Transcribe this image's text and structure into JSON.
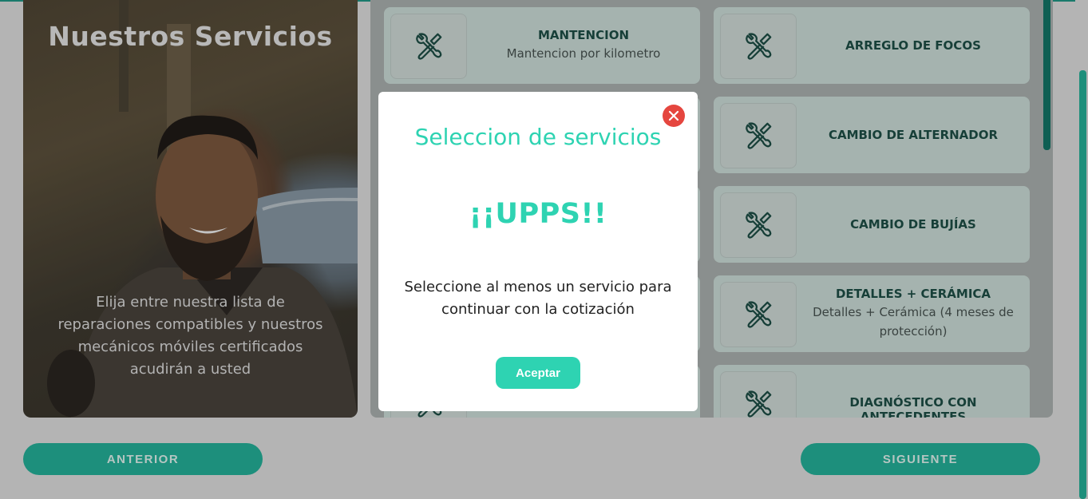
{
  "hero": {
    "title": "Nuestros Servicios",
    "text": "Elija entre nuestra lista de reparaciones compatibles y nuestros mecánicos móviles certificados acudirán a usted"
  },
  "services": [
    {
      "name": "MANTENCION",
      "desc": "Mantencion por kilometro",
      "icon": "wrench-screwdriver-icon"
    },
    {
      "name": "ARREGLO DE FOCOS",
      "desc": "",
      "icon": "wrench-screwdriver-icon"
    },
    {
      "name": "",
      "desc": "",
      "icon": "wrench-screwdriver-icon"
    },
    {
      "name": "CAMBIO DE ALTERNADOR",
      "desc": "",
      "icon": "wrench-screwdriver-icon"
    },
    {
      "name": "",
      "desc": "",
      "icon": "wrench-screwdriver-icon"
    },
    {
      "name": "CAMBIO DE BUJÍAS",
      "desc": "",
      "icon": "wrench-screwdriver-icon"
    },
    {
      "name": "",
      "desc": "",
      "icon": "wrench-screwdriver-icon"
    },
    {
      "name": "DETALLES + CERÁMICA",
      "desc": "Detalles + Cerámica (4 meses de protección)",
      "icon": "wrench-screwdriver-icon"
    },
    {
      "name": "",
      "desc": "",
      "icon": "wrench-screwdriver-icon"
    },
    {
      "name": "DIAGNÓSTICO CON ANTECEDENTES",
      "desc": "",
      "icon": "wrench-screwdriver-icon"
    }
  ],
  "nav": {
    "prev_label": "ANTERIOR",
    "next_label": "SIGUIENTE"
  },
  "modal": {
    "title": "Seleccion de servicios",
    "oops": "¡¡UPPS!!",
    "message": "Seleccione al menos un servicio para continuar con la cotización",
    "accept_label": "Aceptar",
    "close_icon": "close-icon"
  },
  "colors": {
    "accent": "#2ed3b2",
    "primary_dark": "#1d8f7c",
    "close_red": "#e5463f",
    "card_bg": "#a5b3af",
    "service_text": "#173f38"
  }
}
